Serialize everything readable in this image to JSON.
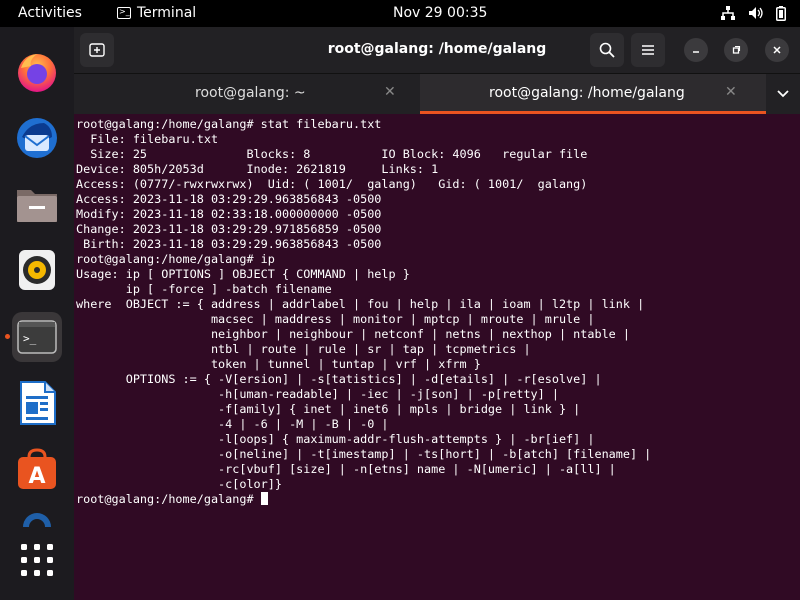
{
  "topbar": {
    "activities": "Activities",
    "app_name": "Terminal",
    "clock": "Nov 29  00:35",
    "tray_icons": [
      "network-icon",
      "volume-icon",
      "battery-icon"
    ]
  },
  "dock": {
    "items": [
      {
        "name": "firefox",
        "icon": "firefox-icon"
      },
      {
        "name": "thunderbird",
        "icon": "thunderbird-icon"
      },
      {
        "name": "files",
        "icon": "files-icon"
      },
      {
        "name": "rhythmbox",
        "icon": "rhythmbox-icon"
      },
      {
        "name": "terminal",
        "icon": "terminal-icon",
        "active": true
      },
      {
        "name": "libreoffice-writer",
        "icon": "writer-icon"
      },
      {
        "name": "app-center",
        "icon": "app-center-icon"
      },
      {
        "name": "help",
        "icon": "help-icon"
      },
      {
        "name": "show-apps",
        "icon": "app-grid-icon"
      }
    ]
  },
  "window": {
    "title": "root@galang: /home/galang",
    "tabs": [
      {
        "label": "root@galang: ~",
        "active": false
      },
      {
        "label": "root@galang: /home/galang",
        "active": true
      }
    ]
  },
  "colors": {
    "terminal_bg": "#300a24",
    "accent": "#e95420",
    "headerbar": "#222124"
  },
  "terminal": {
    "lines": [
      "root@galang:/home/galang# stat filebaru.txt",
      "  File: filebaru.txt",
      "  Size: 25              Blocks: 8          IO Block: 4096   regular file",
      "Device: 805h/2053d      Inode: 2621819     Links: 1",
      "Access: (0777/-rwxrwxrwx)  Uid: ( 1001/  galang)   Gid: ( 1001/  galang)",
      "Access: 2023-11-18 03:29:29.963856843 -0500",
      "Modify: 2023-11-18 02:33:18.000000000 -0500",
      "Change: 2023-11-18 03:29:29.971856859 -0500",
      " Birth: 2023-11-18 03:29:29.963856843 -0500",
      "root@galang:/home/galang# ip",
      "Usage: ip [ OPTIONS ] OBJECT { COMMAND | help }",
      "       ip [ -force ] -batch filename",
      "where  OBJECT := { address | addrlabel | fou | help | ila | ioam | l2tp | link |",
      "                   macsec | maddress | monitor | mptcp | mroute | mrule |",
      "                   neighbor | neighbour | netconf | netns | nexthop | ntable |",
      "                   ntbl | route | rule | sr | tap | tcpmetrics |",
      "                   token | tunnel | tuntap | vrf | xfrm }",
      "       OPTIONS := { -V[ersion] | -s[tatistics] | -d[etails] | -r[esolve] |",
      "                    -h[uman-readable] | -iec | -j[son] | -p[retty] |",
      "                    -f[amily] { inet | inet6 | mpls | bridge | link } |",
      "                    -4 | -6 | -M | -B | -0 |",
      "                    -l[oops] { maximum-addr-flush-attempts } | -br[ief] |",
      "                    -o[neline] | -t[imestamp] | -ts[hort] | -b[atch] [filename] |",
      "                    -rc[vbuf] [size] | -n[etns] name | -N[umeric] | -a[ll] |",
      "                    -c[olor]}",
      "root@galang:/home/galang# "
    ]
  }
}
